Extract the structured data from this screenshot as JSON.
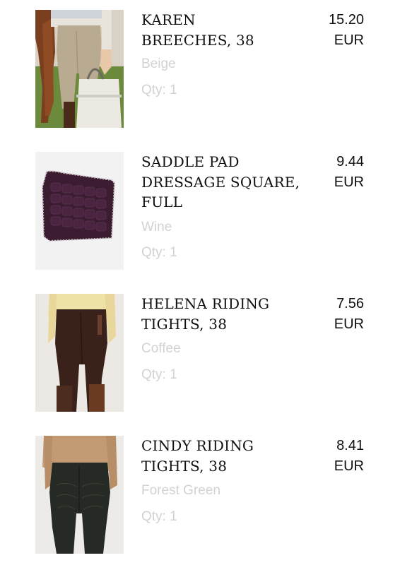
{
  "cart": {
    "items": [
      {
        "name": "KAREN\nBREECHES, 38",
        "color": "Beige",
        "qty": "Qty: 1",
        "price": "15.20",
        "currency": "EUR",
        "image": "beige-breeches-photo"
      },
      {
        "name": "SADDLE PAD\nDRESSAGE SQUARE,\nFULL",
        "color": "Wine",
        "qty": "Qty: 1",
        "price": "9.44",
        "currency": "EUR",
        "image": "wine-saddle-pad-photo"
      },
      {
        "name": "HELENA RIDING\nTIGHTS, 38",
        "color": "Coffee",
        "qty": "Qty: 1",
        "price": "7.56",
        "currency": "EUR",
        "image": "coffee-riding-tights-photo"
      },
      {
        "name": "CINDY RIDING\nTIGHTS, 38",
        "color": "Forest Green",
        "qty": "Qty: 1",
        "price": "8.41",
        "currency": "EUR",
        "image": "forest-green-riding-tights-photo"
      }
    ]
  },
  "colors": {
    "text_primary": "#111111",
    "text_muted": "#d2d2d2",
    "background": "#ffffff"
  }
}
